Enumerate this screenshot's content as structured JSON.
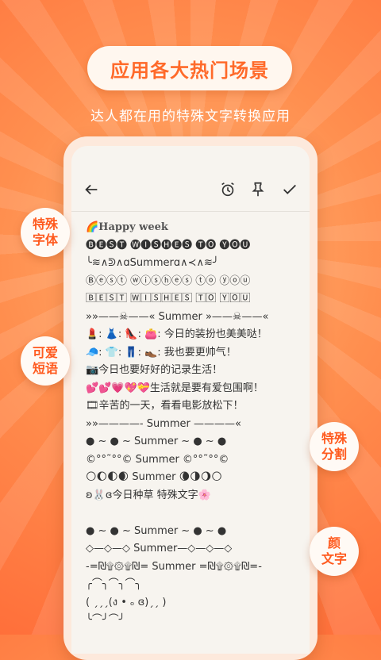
{
  "headline": "应用各大热门场景",
  "subtitle": "达人都在用的特殊文字转换应用",
  "badges": [
    "特殊\n字体",
    "可爱\n短语",
    "特殊\n分割",
    "颜\n文字"
  ],
  "toolbar": {
    "back_icon": "back-arrow-icon",
    "alarm_icon": "alarm-clock-icon",
    "pin_icon": "pin-icon",
    "confirm_icon": "check-icon"
  },
  "lines": [
    "🌈Happy week",
    "🅑🅔🅢🅣 🅦🅘🅢🅗🅔🅢 🅣🅞 🅨🅞🅤",
    "╰≋∧ᕲ∧ɑSummerɑ∧≺∧≋╯",
    "Ⓑⓔⓢⓣ ⓦⓘⓢⓗⓔⓢ ⓣⓞ ⓨⓞⓤ",
    "🄱🄴🅂🅃 🅆🄸🅂🄷🄴🅂 🅃🄾 🅈🄾🅄",
    "»»——☠——« Summer »——☠——«",
    "💄: 👗: 👠: 👛: 今日的装扮也美美哒！",
    "🧢: 👕: 👖: 👞: 我也要更帅气！",
    "📷今日也要好好的记录生活！",
    "💕💕💗💖💝生活就是要有爱包围啊！",
    "🎞辛苦的一天，看看电影放松下！",
    "»»————- Summer ————«",
    "● ~ ● ~  Summer  ~ ● ~ ●",
    "©°°˜°°© Summer ©°°˜°°©",
    "🌕🌔🌓🌒 Summer 🌘🌗🌖🌕",
    "ʚ🐰ɞ今日种草 特殊文字🌸",
    "",
    "● ~ ● ~  Summer  ~ ● ~ ●",
    "◇—◇—◇ Summer—◇—◇—◇",
    "-=₪۩۞۩₪= Summer =₪۩۞۩₪=-",
    "╭⌒╮⌒╮⌒╮",
    "( ˏˏˏ(ง • ₒ ɞ)ˏˏ )",
    "╰⌒╯⌒╯"
  ]
}
